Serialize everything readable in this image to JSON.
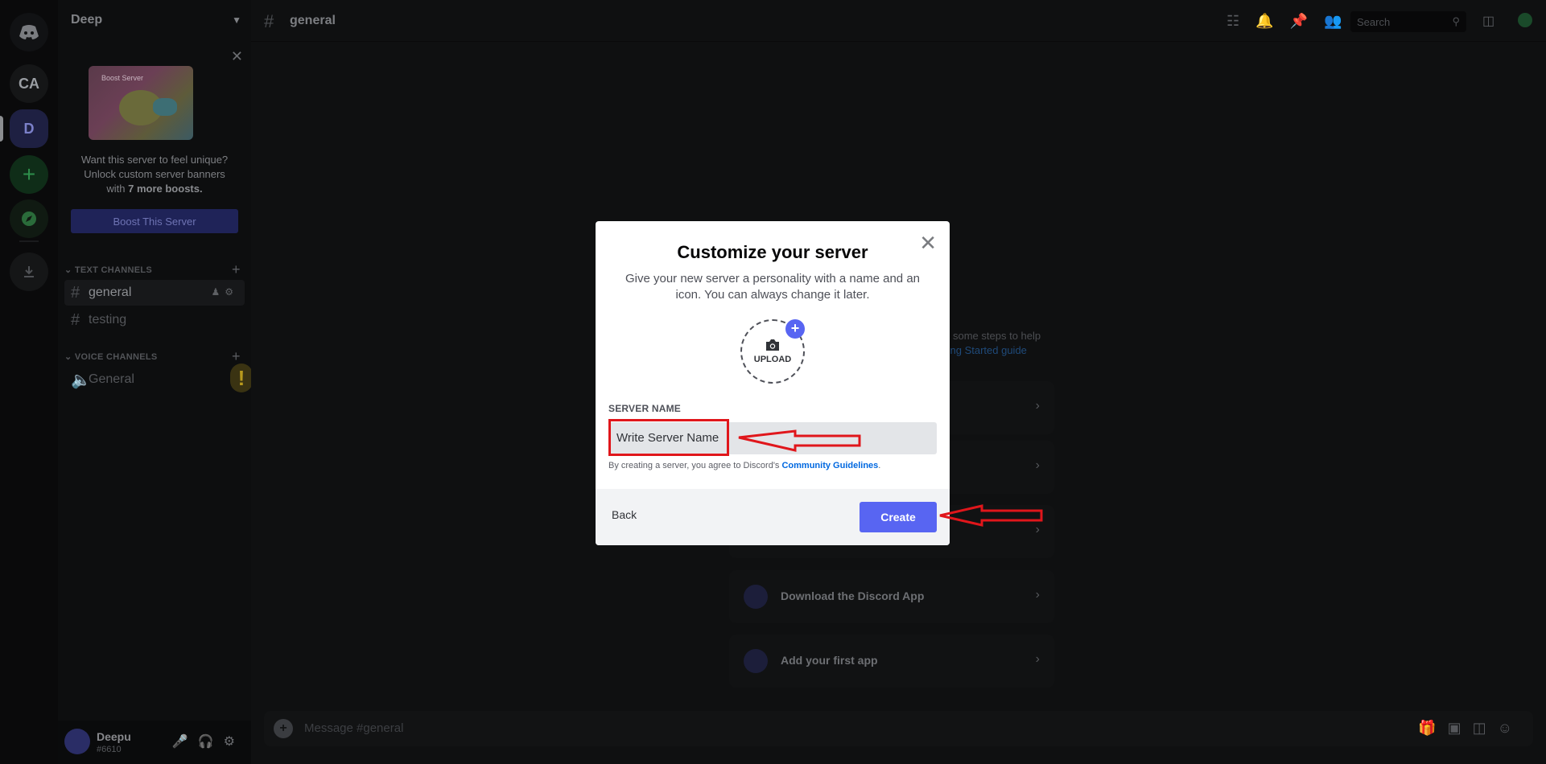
{
  "rail": {
    "ca_label": "CA",
    "d_label": "D",
    "add_label": "+"
  },
  "sidebar": {
    "server_name": "Deep",
    "boost": {
      "image_caption": "Boost Server",
      "text_line1": "Want this server to feel unique?",
      "text_line2": "Unlock custom server banners",
      "text_line3_pre": "with ",
      "text_line3_bold": "7 more boosts.",
      "button_label": "Boost This Server"
    },
    "text_category": "TEXT CHANNELS",
    "voice_category": "VOICE CHANNELS",
    "channels": [
      {
        "name": "general"
      },
      {
        "name": "testing"
      }
    ],
    "voice_channels": [
      {
        "name": "General"
      }
    ]
  },
  "user": {
    "name": "Deepu",
    "tag": "#6610"
  },
  "topbar": {
    "channel": "general",
    "search_placeholder": "Search"
  },
  "main": {
    "peek_text1": "some steps to help",
    "peek_text2": "ting Started guide",
    "tasks": [
      {
        "label": "Download the Discord App"
      },
      {
        "label": "Add your first app"
      }
    ],
    "composer_placeholder": "Message #general"
  },
  "modal": {
    "title": "Customize your server",
    "subtitle": "Give your new server a personality with a name and an icon. You can always change it later.",
    "upload_label": "UPLOAD",
    "field_label": "SERVER NAME",
    "input_value": "Write Server Name",
    "terms_pre": "By creating a server, you agree to Discord's ",
    "terms_link": "Community Guidelines",
    "terms_post": ".",
    "back_label": "Back",
    "create_label": "Create"
  },
  "colors": {
    "accent": "#5865f2",
    "annotation_red": "#e0161b"
  }
}
